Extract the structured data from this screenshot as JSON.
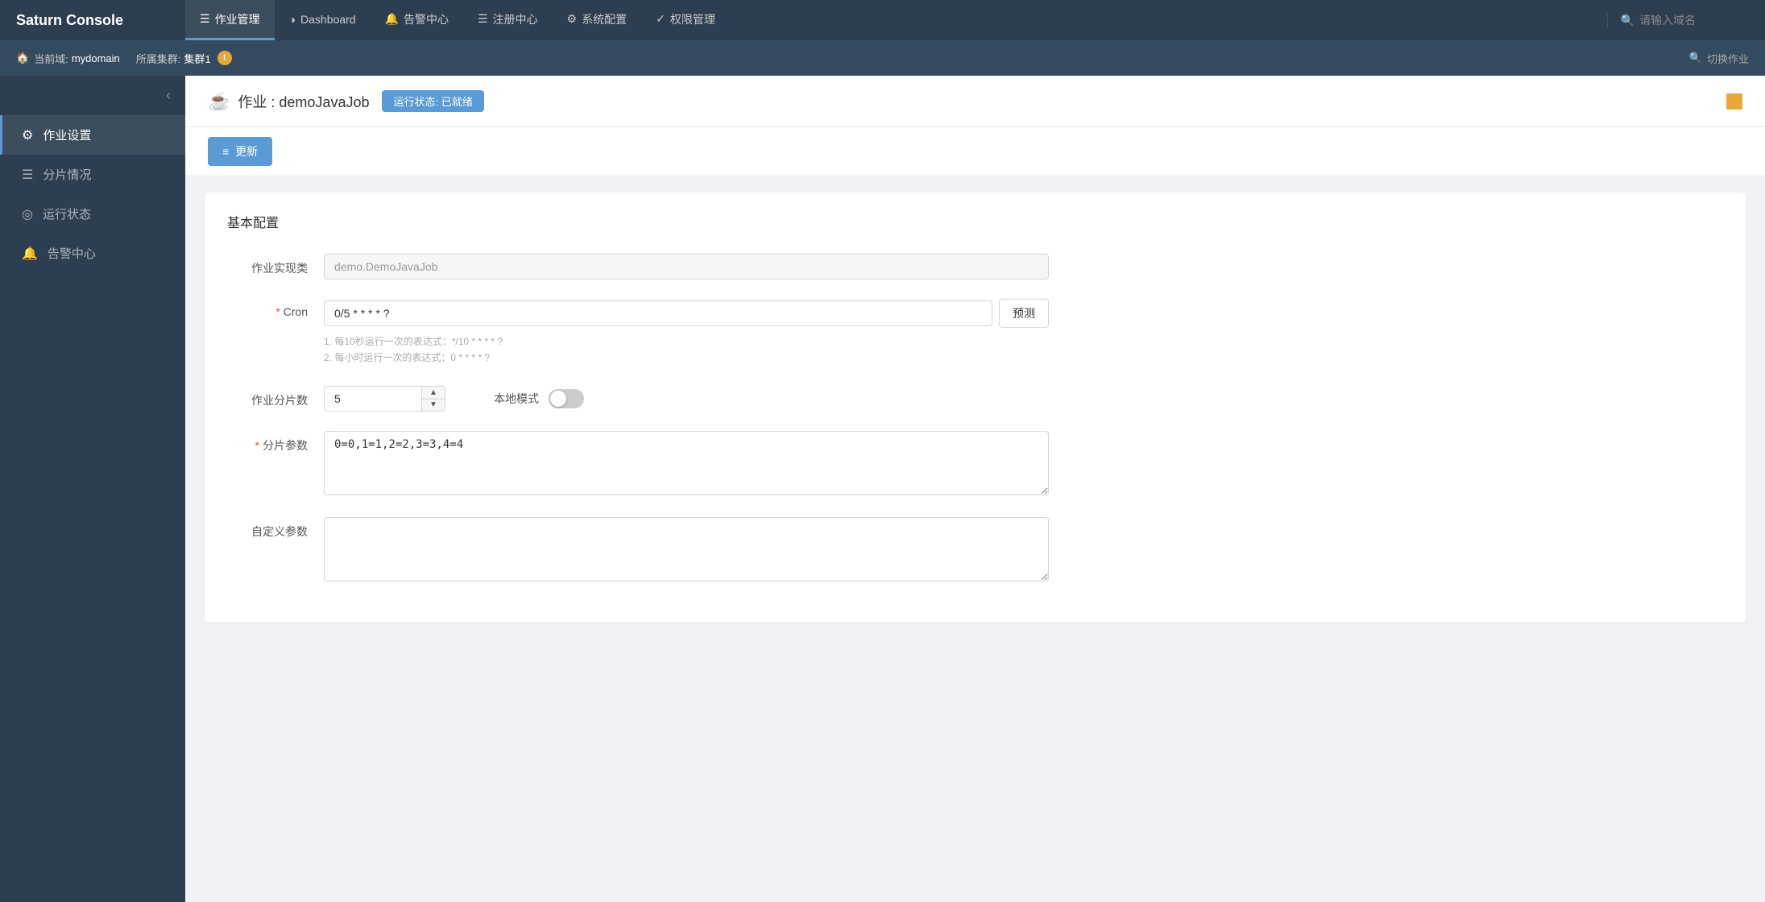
{
  "brand": "Saturn Console",
  "topNav": {
    "items": [
      {
        "id": "job-management",
        "icon": "☰",
        "label": "作业管理",
        "active": true
      },
      {
        "id": "dashboard",
        "icon": "◑",
        "label": "Dashboard",
        "active": false
      },
      {
        "id": "alert-center",
        "icon": "🔔",
        "label": "告警中心",
        "active": false
      },
      {
        "id": "register-center",
        "icon": "☰",
        "label": "注册中心",
        "active": false
      },
      {
        "id": "system-config",
        "icon": "⚙",
        "label": "系统配置",
        "active": false
      },
      {
        "id": "permission",
        "icon": "✓",
        "label": "权限管理",
        "active": false
      }
    ],
    "search": {
      "placeholder": "请输入域名"
    }
  },
  "subNav": {
    "currentDomain": "当前域:",
    "domainName": "mydomain",
    "clusterLabel": "所属集群:",
    "clusterName": "集群1",
    "switchJobLabel": "切换作业"
  },
  "sidebar": {
    "collapseLabel": "‹",
    "items": [
      {
        "id": "job-settings",
        "icon": "⚙",
        "label": "作业设置",
        "active": true
      },
      {
        "id": "shard-status",
        "icon": "☰",
        "label": "分片情况",
        "active": false
      },
      {
        "id": "run-status",
        "icon": "◎",
        "label": "运行状态",
        "active": false
      },
      {
        "id": "alert-center-side",
        "icon": "🔔",
        "label": "告警中心",
        "active": false
      }
    ]
  },
  "jobHeader": {
    "icon": "☕",
    "title": "作业 : demoJavaJob",
    "statusBadge": "运行状态: 已就绪"
  },
  "toolbar": {
    "updateButton": "更新"
  },
  "basicConfig": {
    "sectionTitle": "基本配置",
    "fields": {
      "jobClass": {
        "label": "作业实现类",
        "value": "demo.DemoJavaJob",
        "placeholder": "demo.DemoJavaJob"
      },
      "cron": {
        "label": "Cron",
        "value": "0/5 * * * * ?",
        "predictButton": "预测",
        "hints": [
          "1. 每10秒运行一次的表达式：*/10 * * * * ?",
          "2. 每小时运行一次的表达式：0 * * * * ?"
        ]
      },
      "shards": {
        "label": "作业分片数",
        "value": "5"
      },
      "localMode": {
        "label": "本地模式",
        "enabled": false
      },
      "shardParams": {
        "label": "分片参数",
        "value": "0=0,1=1,2=2,3=3,4=4"
      },
      "customParams": {
        "label": "自定义参数",
        "value": ""
      }
    }
  }
}
